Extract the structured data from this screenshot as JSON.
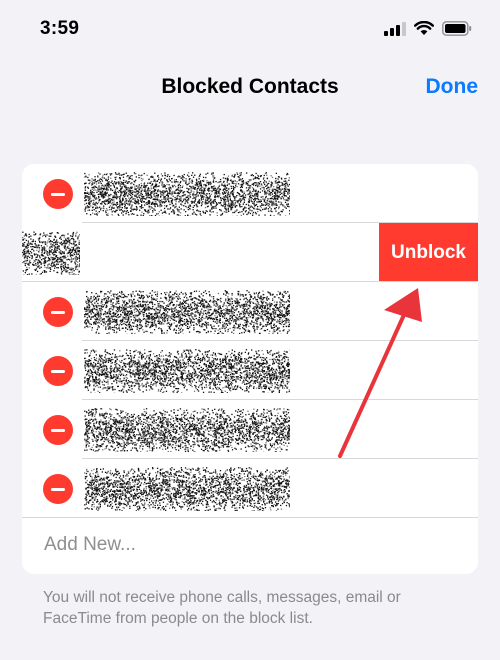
{
  "status_bar": {
    "time": "3:59"
  },
  "nav": {
    "title": "Blocked Contacts",
    "done_label": "Done"
  },
  "contacts": {
    "swiped_row_index": 1,
    "unblock_label": "Unblock",
    "count": 6
  },
  "add_new_label": "Add New...",
  "footer_note": "You will not receive phone calls, messages, email or FaceTime from people on the block list.",
  "colors": {
    "accent": "#0a7aff",
    "destructive": "#ff3b30",
    "background": "#f2f2f7",
    "annotation_arrow": "#e8343a"
  },
  "icons": [
    "signal-icon",
    "wifi-icon",
    "battery-icon",
    "minus-circle-icon",
    "annotation-arrow-icon"
  ]
}
